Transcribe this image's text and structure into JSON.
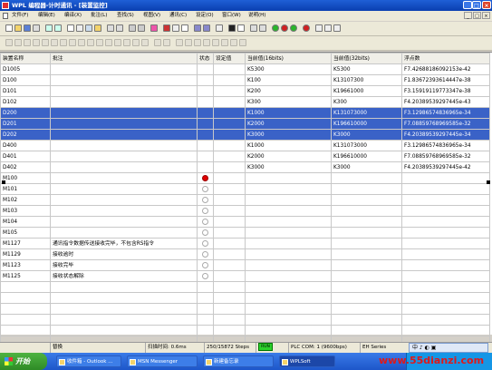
{
  "window": {
    "title": "WPL 编程器-计时通讯 - [装置监控]",
    "controls": [
      "_",
      "□",
      "×"
    ]
  },
  "menu": {
    "items": [
      "文件(F)",
      "编辑(E)",
      "编译(X)",
      "批注(L)",
      "查找(S)",
      "视图(V)",
      "通讯(C)",
      "设定(O)",
      "窗口(W)",
      "说明(H)"
    ],
    "mdi_controls": [
      "_",
      "□",
      "×"
    ]
  },
  "table": {
    "columns": [
      "装置名称",
      "批注",
      "状态",
      "设定值",
      "当前值(16bits)",
      "当前值(32bits)",
      "浮点数"
    ],
    "rows": [
      {
        "name": "D1005",
        "comment": "",
        "status": "",
        "set": "",
        "v16": "K5300",
        "v32": "K5300",
        "float": "F7.42688186092153e-42",
        "selected": false
      },
      {
        "name": "D100",
        "comment": "",
        "status": "",
        "set": "",
        "v16": "K100",
        "v32": "K13107300",
        "float": "F1.83672393614447e-38",
        "selected": false
      },
      {
        "name": "D101",
        "comment": "",
        "status": "",
        "set": "",
        "v16": "K200",
        "v32": "K19661000",
        "float": "F3.15919119773347e-38",
        "selected": false
      },
      {
        "name": "D102",
        "comment": "",
        "status": "",
        "set": "",
        "v16": "K300",
        "v32": "K300",
        "float": "F4.20389539297445e-43",
        "selected": false
      },
      {
        "name": "D200",
        "comment": "",
        "status": "",
        "set": "",
        "v16": "K1000",
        "v32": "K131073000",
        "float": "F3.12986574836965e-34",
        "selected": true
      },
      {
        "name": "D201",
        "comment": "",
        "status": "",
        "set": "",
        "v16": "K2000",
        "v32": "K196610000",
        "float": "F7.08859768969585e-32",
        "selected": true
      },
      {
        "name": "D202",
        "comment": "",
        "status": "",
        "set": "",
        "v16": "K3000",
        "v32": "K3000",
        "float": "F4.20389539297445e-34",
        "selected": true
      },
      {
        "name": "D400",
        "comment": "",
        "status": "",
        "set": "",
        "v16": "K1000",
        "v32": "K131073000",
        "float": "F3.12986574836965e-34",
        "selected": false
      },
      {
        "name": "D401",
        "comment": "",
        "status": "",
        "set": "",
        "v16": "K2000",
        "v32": "K196610000",
        "float": "F7.08859768969585e-32",
        "selected": false
      },
      {
        "name": "D402",
        "comment": "",
        "status": "",
        "set": "",
        "v16": "K3000",
        "v32": "K3000",
        "float": "F4.20389539297445e-42",
        "selected": false
      },
      {
        "name": "M100",
        "comment": "",
        "status": "on",
        "set": "",
        "v16": "",
        "v32": "",
        "float": "",
        "selected": false
      },
      {
        "name": "M101",
        "comment": "",
        "status": "off",
        "set": "",
        "v16": "",
        "v32": "",
        "float": "",
        "selected": false
      },
      {
        "name": "M102",
        "comment": "",
        "status": "off",
        "set": "",
        "v16": "",
        "v32": "",
        "float": "",
        "selected": false
      },
      {
        "name": "M103",
        "comment": "",
        "status": "off",
        "set": "",
        "v16": "",
        "v32": "",
        "float": "",
        "selected": false
      },
      {
        "name": "M104",
        "comment": "",
        "status": "off",
        "set": "",
        "v16": "",
        "v32": "",
        "float": "",
        "selected": false
      },
      {
        "name": "M105",
        "comment": "",
        "status": "off",
        "set": "",
        "v16": "",
        "v32": "",
        "float": "",
        "selected": false
      },
      {
        "name": "M1127",
        "comment": "通讯指令数据传送接收完毕，不包含RS指令",
        "status": "off",
        "set": "",
        "v16": "",
        "v32": "",
        "float": "",
        "selected": false
      },
      {
        "name": "M1129",
        "comment": "接收逾时",
        "status": "off",
        "set": "",
        "v16": "",
        "v32": "",
        "float": "",
        "selected": false
      },
      {
        "name": "M1123",
        "comment": "接收完毕",
        "status": "off",
        "set": "",
        "v16": "",
        "v32": "",
        "float": "",
        "selected": false
      },
      {
        "name": "M1125",
        "comment": "接收状态解除",
        "status": "off",
        "set": "",
        "v16": "",
        "v32": "",
        "float": "",
        "selected": false
      },
      {
        "name": "",
        "comment": "",
        "status": "",
        "set": "",
        "v16": "",
        "v32": "",
        "float": "",
        "selected": false
      },
      {
        "name": "",
        "comment": "",
        "status": "",
        "set": "",
        "v16": "",
        "v32": "",
        "float": "",
        "selected": false
      },
      {
        "name": "",
        "comment": "",
        "status": "",
        "set": "",
        "v16": "",
        "v32": "",
        "float": "",
        "selected": false
      },
      {
        "name": "",
        "comment": "",
        "status": "",
        "set": "",
        "v16": "",
        "v32": "",
        "float": "",
        "selected": false
      },
      {
        "name": "",
        "comment": "",
        "status": "",
        "set": "",
        "v16": "",
        "v32": "",
        "float": "",
        "selected": false
      },
      {
        "name": "",
        "comment": "",
        "status": "",
        "set": "",
        "v16": "",
        "v32": "",
        "float": "",
        "selected": false
      },
      {
        "name": "",
        "comment": "",
        "status": "",
        "set": "",
        "v16": "",
        "v32": "",
        "float": "",
        "selected": false
      }
    ]
  },
  "status": {
    "mode": "替换",
    "scan": "扫描时间: 0.6ms",
    "steps": "250/15872 Steps",
    "run": "RUN",
    "comm": "PLC COM: 1  (9600bps)",
    "model": "EH Series"
  },
  "taskbar": {
    "start": "开始",
    "tasks": [
      "收件箱 - Outlook ...",
      "MSN Messenger",
      "新建备忘录",
      "WPLSoft"
    ],
    "ime": "中 ♪ ◐ ▣"
  },
  "watermark": "www.55dianzi.com",
  "colors": {
    "selection": "#3a62c7",
    "status_on": "#e00000",
    "run": "#2bd12b"
  }
}
